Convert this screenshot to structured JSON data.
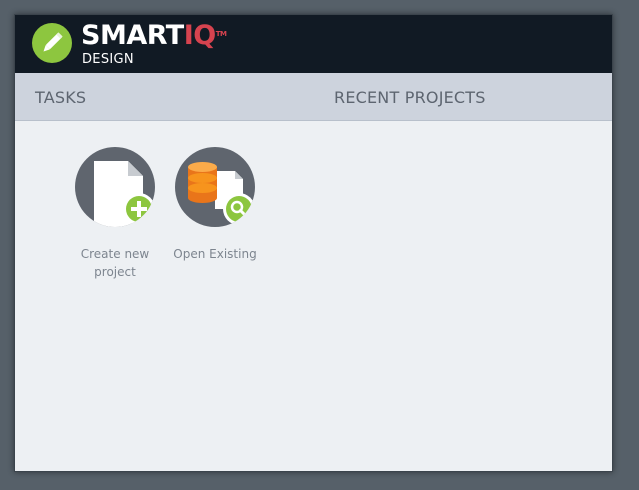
{
  "app": {
    "brand_main": "SMART",
    "brand_accent": "IQ",
    "trademark": "TM",
    "subtitle": "DESIGN"
  },
  "sections": {
    "tasks": "TASKS",
    "recent": "RECENT PROJECTS"
  },
  "tasks": [
    {
      "label": "Create new project",
      "icon": "new-document-plus-icon"
    },
    {
      "label": "Open Existing",
      "icon": "database-search-icon"
    }
  ],
  "colors": {
    "header_bg": "#111a24",
    "accent_green": "#8dc63f",
    "accent_red": "#d6434f",
    "accent_orange": "#f58220",
    "section_bar": "#cdd3dd",
    "content_bg": "#edf0f3"
  }
}
